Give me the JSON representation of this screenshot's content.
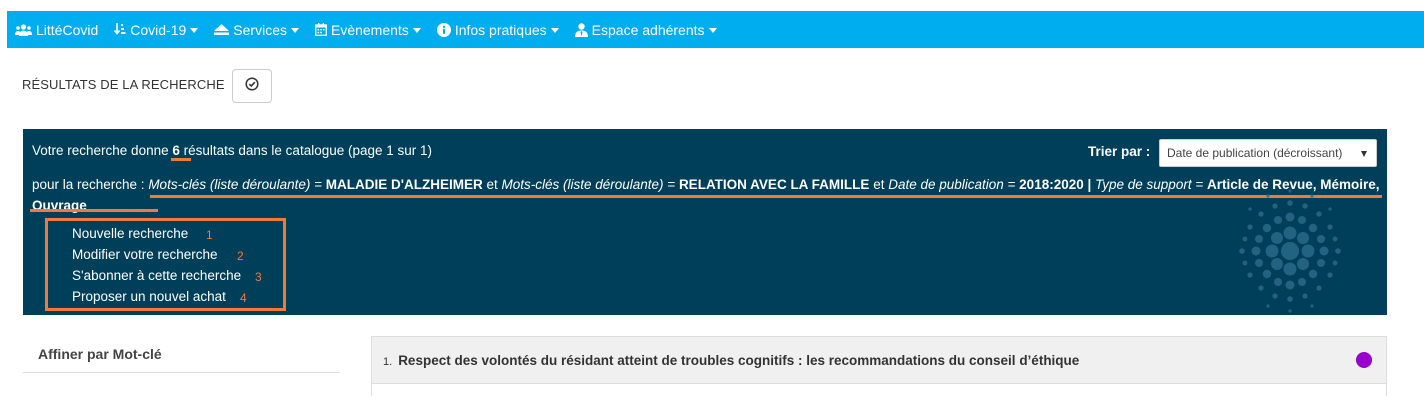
{
  "nav": {
    "items": [
      {
        "label": "LittéCovid",
        "icon": "users-icon",
        "dropdown": false
      },
      {
        "label": "Covid-19",
        "icon": "sort-icon",
        "dropdown": true
      },
      {
        "label": "Services",
        "icon": "eject-icon",
        "dropdown": true
      },
      {
        "label": "Evènements",
        "icon": "calendar-icon",
        "dropdown": true
      },
      {
        "label": "Infos pratiques",
        "icon": "info-icon",
        "dropdown": true
      },
      {
        "label": "Espace adhérents",
        "icon": "user-tie-icon",
        "dropdown": true
      }
    ],
    "color": "#00aeef"
  },
  "page": {
    "title": "RÉSULTATS DE LA RECHERCHE",
    "toggle_icon": "check-circle-icon"
  },
  "results": {
    "summary_before": "Votre recherche donne ",
    "count": "6",
    "summary_after": " résultats dans le catalogue (page 1 sur 1)",
    "sort_label": "Trier par :",
    "sort_value": "Date de publication (décroissant)",
    "query_prefix": "pour la recherche : ",
    "q_field1": "Mots-clés (liste déroulante) = ",
    "q_value1": "MALADIE D'ALZHEIMER",
    "q_and1": " et ",
    "q_field2": "Mots-clés (liste déroulante) = ",
    "q_value2": "RELATION AVEC LA FAMILLE",
    "q_and2": " et ",
    "q_field3": "Date de publication = ",
    "q_value3": "2018:2020",
    "q_pipe": " | ",
    "q_field4": "Type de support = ",
    "q_value4": "Article de Revue, Mémoire, Ouvrage",
    "panel_color": "#003f5a",
    "accent": "#f07a3a"
  },
  "actions": [
    {
      "label": "Nouvelle recherche",
      "num": "1"
    },
    {
      "label": "Modifier votre recherche",
      "num": "2"
    },
    {
      "label": "S'abonner à cette recherche",
      "num": "3"
    },
    {
      "label": "Proposer un nouvel achat",
      "num": "4"
    }
  ],
  "facets": {
    "title": "Affiner par Mot-clé"
  },
  "result_list": [
    {
      "index": "1.",
      "title": "Respect des volontés du résidant atteint de troubles cognitifs : les recommandations du conseil d’éthique",
      "dot_color": "#9900cc"
    }
  ]
}
